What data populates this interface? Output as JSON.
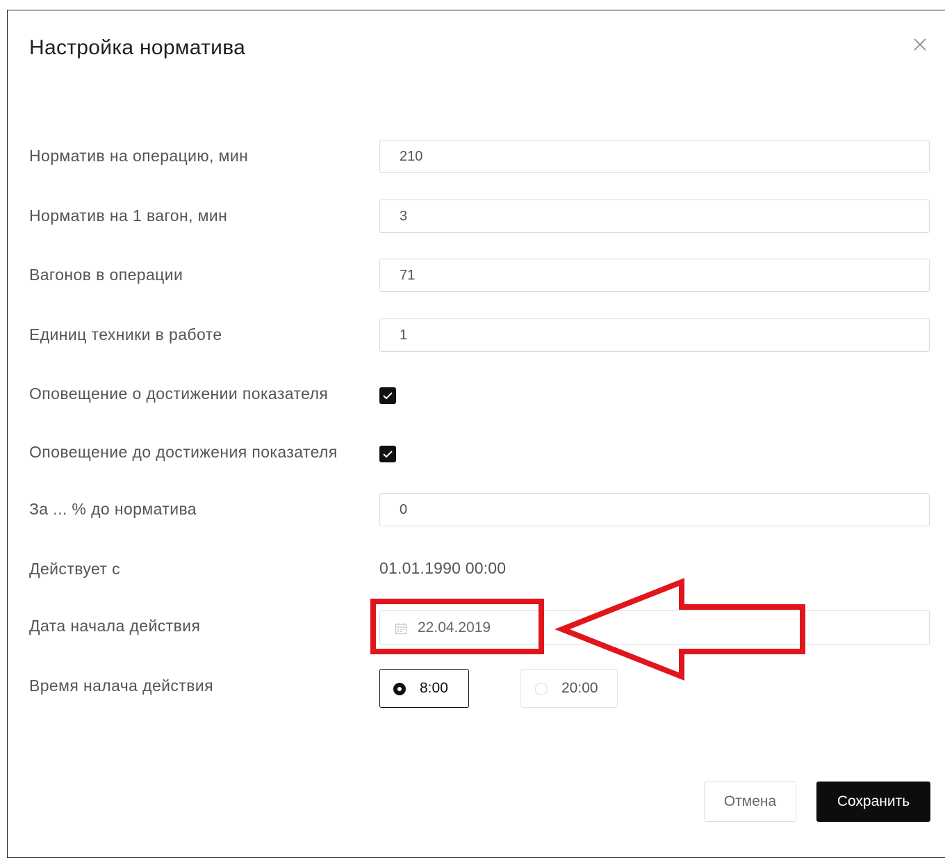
{
  "dialog": {
    "title": "Настройка норматива",
    "close_icon": "close-icon"
  },
  "fields": {
    "norm_operation": {
      "label": "Норматив на операцию, мин",
      "value": "210"
    },
    "norm_wagon": {
      "label": "Норматив на 1 вагон, мин",
      "value": "3"
    },
    "wagons_in_operation": {
      "label": "Вагонов в операции",
      "value": "71"
    },
    "units_in_work": {
      "label": "Единиц техники в работе",
      "value": "1"
    },
    "notify_on_reach": {
      "label": "Оповещение о достижении показателя",
      "checked": true
    },
    "notify_before_reach": {
      "label": "Оповещение до достижения показателя",
      "checked": true
    },
    "percent_before": {
      "label": "За ... % до норматива",
      "value": "0"
    },
    "valid_from": {
      "label": "Действует с",
      "value": "01.01.1990 00:00"
    },
    "start_date": {
      "label": "Дата начала действия",
      "value": "22.04.2019",
      "icon": "calendar-icon"
    },
    "start_time": {
      "label": "Время налача действия",
      "options": [
        {
          "label": "8:00",
          "selected": true
        },
        {
          "label": "20:00",
          "selected": false
        }
      ]
    }
  },
  "footer": {
    "cancel_label": "Отмена",
    "save_label": "Сохранить"
  },
  "annotation": {
    "color": "#e0161c",
    "shape": "red-rectangle-and-arrow-pointing-left"
  }
}
